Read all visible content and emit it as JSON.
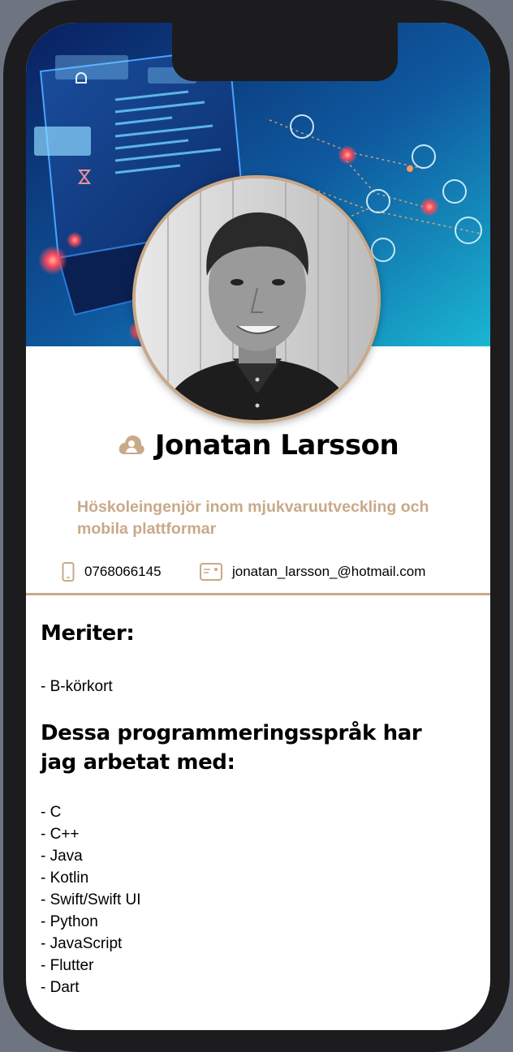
{
  "profile": {
    "name": "Jonatan Larsson",
    "title": "Höskoleingenjör inom mjukvaruutveckling och mobila plattformar",
    "phone": "0768066145",
    "email": "jonatan_larsson_@hotmail.com"
  },
  "icons": {
    "name": "person-cloud-icon",
    "phone": "phone-icon",
    "email": "contact-card-icon"
  },
  "colors": {
    "accent": "#c8a989",
    "banner_dark": "#0b2a63",
    "banner_light": "#1fb3d0",
    "text": "#000000",
    "bezel": "#1c1c1e"
  },
  "merits": {
    "heading": "Meriter:",
    "items": [
      "- B-körkort"
    ]
  },
  "languages": {
    "heading": "Dessa programmeringsspråk har jag arbetat med:",
    "items": [
      "- C",
      "- C++",
      "- Java",
      "- Kotlin",
      "- Swift/Swift UI",
      "- Python",
      "- JavaScript",
      "- Flutter",
      "- Dart"
    ]
  }
}
